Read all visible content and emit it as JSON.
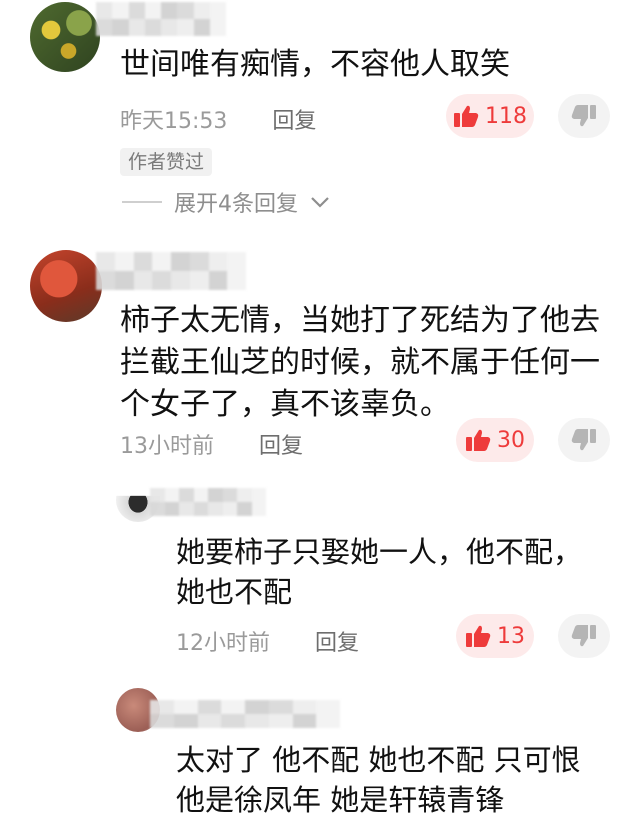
{
  "comments": [
    {
      "text": "世间唯有痴情，不容他人取笑",
      "time": "昨天15:53",
      "reply_label": "回复",
      "likes": "118",
      "tag": "作者赞过",
      "expand": "展开4条回复"
    },
    {
      "text": "柿子太无情，当她打了死结为了他去拦截王仙芝的时候，就不属于任何一个女子了，真不该辜负。",
      "time": "13小时前",
      "reply_label": "回复",
      "likes": "30"
    }
  ],
  "replies": [
    {
      "text": "她要柿子只娶她一人，他不配，她也不配",
      "time": "12小时前",
      "reply_label": "回复",
      "likes": "13"
    },
    {
      "text": "太对了 他不配 她也不配 只可恨他是徐凤年 她是轩辕青锋"
    }
  ],
  "colors": {
    "like_red": "#ee3b3b",
    "like_bg": "#fdeaea",
    "meta_gray": "#9a9a9a"
  },
  "icons": {
    "like": "thumbs-up-icon",
    "dislike": "thumbs-down-icon",
    "expand": "chevron-down-icon"
  }
}
